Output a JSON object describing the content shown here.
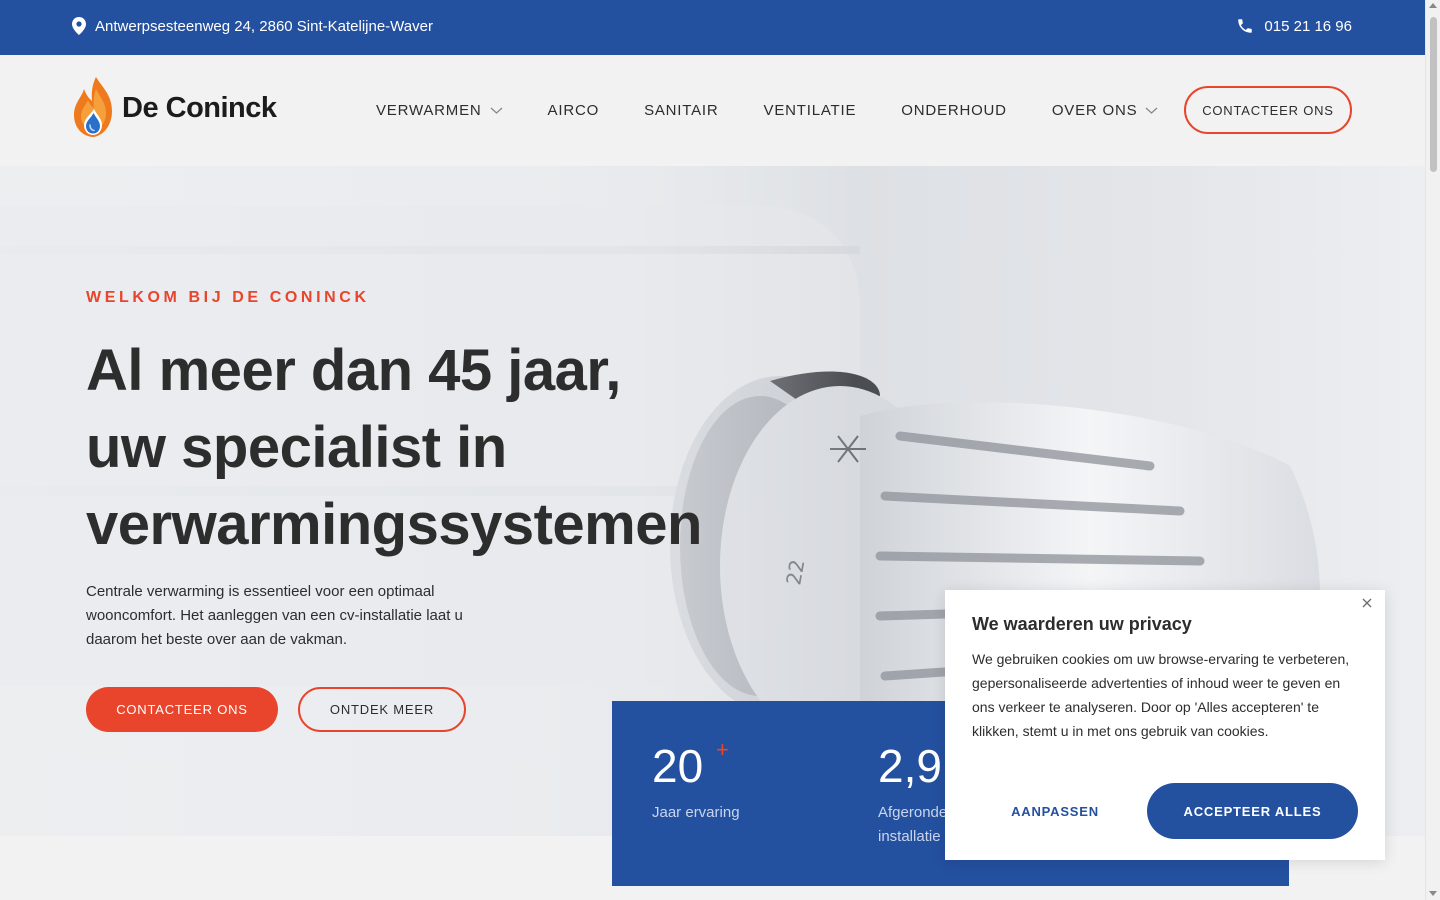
{
  "topbar": {
    "address": "Antwerpsesteenweg 24, 2860 Sint-Katelijne-Waver",
    "phone": "015 21 16 96",
    "address_icon": "map-pin-icon",
    "phone_icon": "phone-icon"
  },
  "header": {
    "logo_text": "De Coninck",
    "nav": [
      {
        "label": "VERWARMEN",
        "has_dropdown": true
      },
      {
        "label": "AIRCO",
        "has_dropdown": false
      },
      {
        "label": "SANITAIR",
        "has_dropdown": false
      },
      {
        "label": "VENTILATIE",
        "has_dropdown": false
      },
      {
        "label": "ONDERHOUD",
        "has_dropdown": false
      },
      {
        "label": "OVER ONS",
        "has_dropdown": true
      }
    ],
    "cta_label": "CONTACTEER ONS"
  },
  "hero": {
    "eyebrow": "WELKOM BIJ DE CONINCK",
    "headline_lines": [
      "Al meer dan 45 jaar,",
      "uw specialist in",
      "verwarmingssystemen"
    ],
    "intro": "Centrale verwarming is essentieel voor een optimaal wooncomfort. Het aanleggen van een cv-installatie laat u daarom het beste over aan de vakman.",
    "primary_button": "CONTACTEER ONS",
    "secondary_button": "ONTDEK MEER"
  },
  "stats": [
    {
      "number": "20",
      "suffix": "+",
      "label": "Jaar ervaring"
    },
    {
      "number": "2,9",
      "suffix": "",
      "label": "Afgeronde installatie"
    }
  ],
  "cookie": {
    "title": "We waarderen uw privacy",
    "text": "We gebruiken cookies om uw browse-ervaring te verbeteren, gepersonaliseerde advertenties of inhoud weer te geven en ons verkeer te analyseren. Door op 'Alles accepteren' te klikken, stemt u in met ons gebruik van cookies.",
    "customize_label": "AANPASSEN",
    "accept_label": "ACCEPTEER ALLES"
  },
  "colors": {
    "brand_blue": "#2450a0",
    "accent_orange": "#e8452c"
  }
}
